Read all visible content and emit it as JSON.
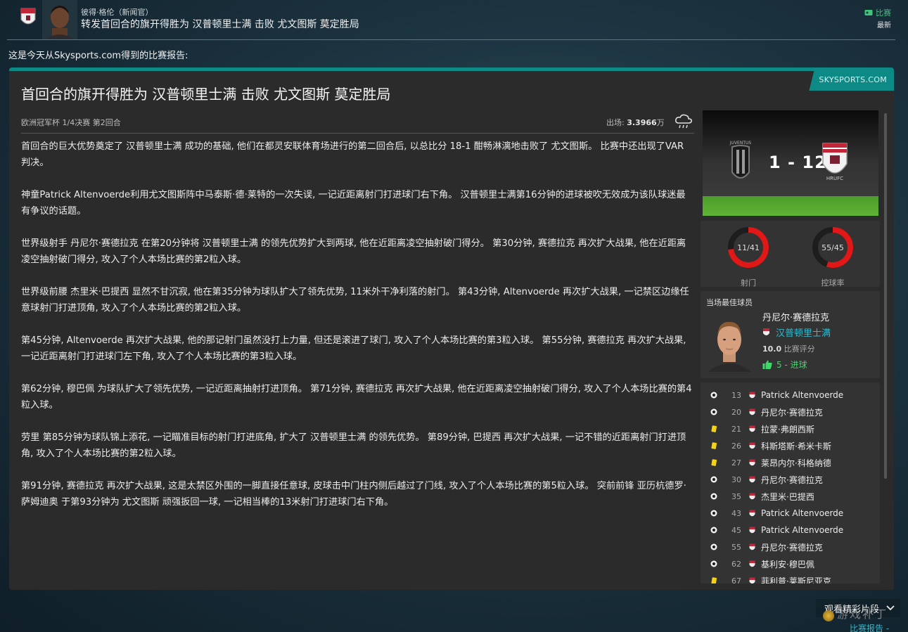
{
  "header": {
    "sender": "彼得·格伦（新闻官）",
    "subject": "转发首回合的旗开得胜为 汉普顿里士满 击败 尤文图斯 莫定胜局",
    "tag": "比赛",
    "tag_sub": "最新"
  },
  "intro": "这是今天从Skysports.com得到的比赛报告:",
  "article": {
    "source": "SKYSPORTS.COM",
    "title": "首回合的旗开得胜为 汉普顿里士满 击败 尤文图斯 莫定胜局",
    "competition": "欧洲冠军杯 1/4决赛 第2回合",
    "attendance_label": "出场: ",
    "attendance_value": "3.3966",
    "attendance_unit": "万",
    "paragraphs": [
      "首回合的巨大优势奠定了 汉普顿里士满 成功的基础, 他们在都灵安联体育场进行的第二回合后, 以总比分 18-1 酣畅淋漓地击败了 尤文图斯。 比赛中还出现了VAR判决。",
      "神童Patrick Altenvoerde利用尤文图斯阵中马泰斯·德·莱特的一次失误, 一记近距离射门打进球门右下角。 汉普顿里士满第16分钟的进球被吹无效成为该队球迷最有争议的话题。",
      "世界级射手 丹尼尔·赛德拉克 在第20分钟将 汉普顿里士满 的领先优势扩大到两球, 他在近距离凌空抽射破门得分。 第30分钟, 赛德拉克 再次扩大战果, 他在近距离凌空抽射破门得分, 攻入了个人本场比赛的第2粒入球。",
      "世界级前腰 杰里米·巴提西 显然不甘沉寂, 他在第35分钟为球队扩大了领先优势, 11米外干净利落的射门。 第43分钟, Altenvoerde 再次扩大战果, 一记禁区边缘任意球射门打进顶角, 攻入了个人本场比赛的第2粒入球。",
      "第45分钟, Altenvoerde 再次扩大战果, 他的那记射门虽然没打上力量, 但还是滚进了球门, 攻入了个人本场比赛的第3粒入球。 第55分钟, 赛德拉克 再次扩大战果, 一记近距离射门打进球门左下角, 攻入了个人本场比赛的第3粒入球。",
      "第62分钟, 穆巴佩 为球队扩大了领先优势, 一记近距离抽射打进顶角。 第71分钟, 赛德拉克 再次扩大战果, 他在近距离凌空抽射破门得分, 攻入了个人本场比赛的第4粒入球。",
      "劳里 第85分钟为球队锦上添花, 一记瞄准目标的射门打进底角, 扩大了 汉普顿里士满 的领先优势。 第89分钟, 巴提西 再次扩大战果, 一记不错的近距离射门打进顶角, 攻入了个人本场比赛的第2粒入球。",
      "第91分钟, 赛德拉克 再次扩大战果, 这是太禁区外围的一脚直接任意球, 皮球击中门柱内侧后越过了门线, 攻入了个人本场比赛的第5粒入球。 突前前锋 亚历杭德罗·萨姆迪奥 于第93分钟为 尤文图斯 顽强扳回一球, 一记相当棒的13米射门打进球门右下角。"
    ]
  },
  "scoreboard": {
    "score": "1 - 12",
    "home_badge_text": "JUVENTUS",
    "away_badge_text": "HRUFC"
  },
  "stats": {
    "shots": {
      "value": "11/41",
      "label": "射门",
      "home_fraction": 0.268
    },
    "possession": {
      "value": "55/45",
      "label": "控球率",
      "home_fraction": 0.55
    }
  },
  "potm": {
    "title": "当场最佳球员",
    "name": "丹尼尔·赛德拉克",
    "club": "汉普顿里士满",
    "rating": "10.0",
    "rating_label": "比赛评分",
    "goals": "5 - 进球"
  },
  "events": [
    {
      "type": "goal",
      "minute": "13",
      "player": "Patrick Altenvoerde"
    },
    {
      "type": "goal",
      "minute": "20",
      "player": "丹尼尔·赛德拉克"
    },
    {
      "type": "yellow",
      "minute": "21",
      "player": "拉蒙·弗朗西斯"
    },
    {
      "type": "yellow",
      "minute": "26",
      "player": "科斯塔斯·希米卡斯"
    },
    {
      "type": "yellow",
      "minute": "27",
      "player": "莱昂内尔·科格纳德"
    },
    {
      "type": "goal",
      "minute": "30",
      "player": "丹尼尔·赛德拉克"
    },
    {
      "type": "goal",
      "minute": "35",
      "player": "杰里米·巴提西"
    },
    {
      "type": "goal",
      "minute": "43",
      "player": "Patrick Altenvoerde"
    },
    {
      "type": "goal",
      "minute": "45",
      "player": "Patrick Altenvoerde"
    },
    {
      "type": "goal",
      "minute": "55",
      "player": "丹尼尔·赛德拉克"
    },
    {
      "type": "goal",
      "minute": "62",
      "player": "基利安·穆巴佩"
    },
    {
      "type": "yellow",
      "minute": "67",
      "player": "菲利普·莱斯尼亚克"
    }
  ],
  "footer": {
    "highlights": "观看精彩片段",
    "report": "比赛报告 -",
    "watermark": "游戏补丁"
  },
  "colors": {
    "accent": "#0e8a86",
    "link": "#3ab6c8",
    "positive": "#3fd76a",
    "ring_red": "#e01818"
  }
}
